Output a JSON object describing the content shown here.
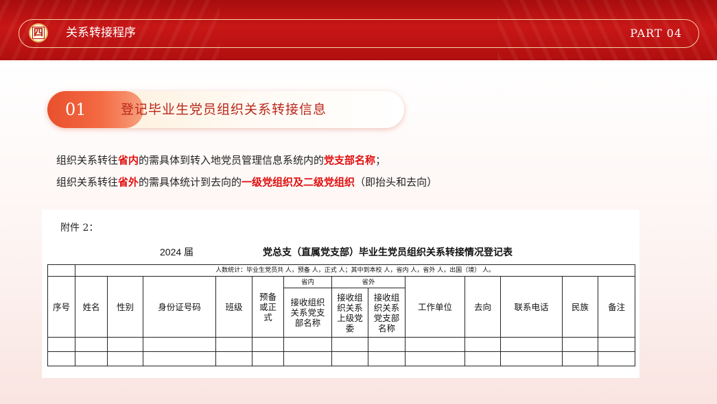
{
  "header": {
    "section_num": "四",
    "section_title": "关系转接程序",
    "part_label": "PART 04"
  },
  "pill": {
    "num": "01",
    "text": "登记毕业生党员组织关系转接信息"
  },
  "paragraph": {
    "line1": {
      "pre": "组织关系转往",
      "hl1": "省内",
      "mid": "的需具体到转入地党员管理信息系统内的",
      "hl2": "党支部名称",
      "post": "；"
    },
    "line2": {
      "pre": "组织关系转往",
      "hl1": "省外",
      "mid": "的需具体统计到去向的",
      "hl2": "一级党组织及二级党组织",
      "post": "（即抬头和去向）"
    }
  },
  "document": {
    "attachment": "附件 2：",
    "year": "2024 届",
    "title": "党总支（直属党支部）毕业生党员组织关系转接情况登记表",
    "stats_row": "人数统计：毕业生党员共  人，预备    人，正式    人；其中到本校   人，省内  人，省外    人，出国（境）   人。",
    "group_in": "省内",
    "group_out": "省外",
    "headers": {
      "no": "序号",
      "name": "姓名",
      "gender": "性别",
      "id": "身份证号码",
      "class": "班级",
      "status": "预备或正式",
      "in_branch": "接收组织关系党支部名称",
      "out_upper": "接收组织关系上级党委",
      "out_branch": "接收组织关系党支部名称",
      "unit": "工作单位",
      "dest": "去向",
      "phone": "联系电话",
      "ethnic": "民族",
      "note": "备注"
    }
  },
  "colors": {
    "header_red": "#c81616",
    "accent_gold": "#f3d6a4",
    "highlight_red": "#e01010",
    "pill_orange": "#f36a42"
  }
}
